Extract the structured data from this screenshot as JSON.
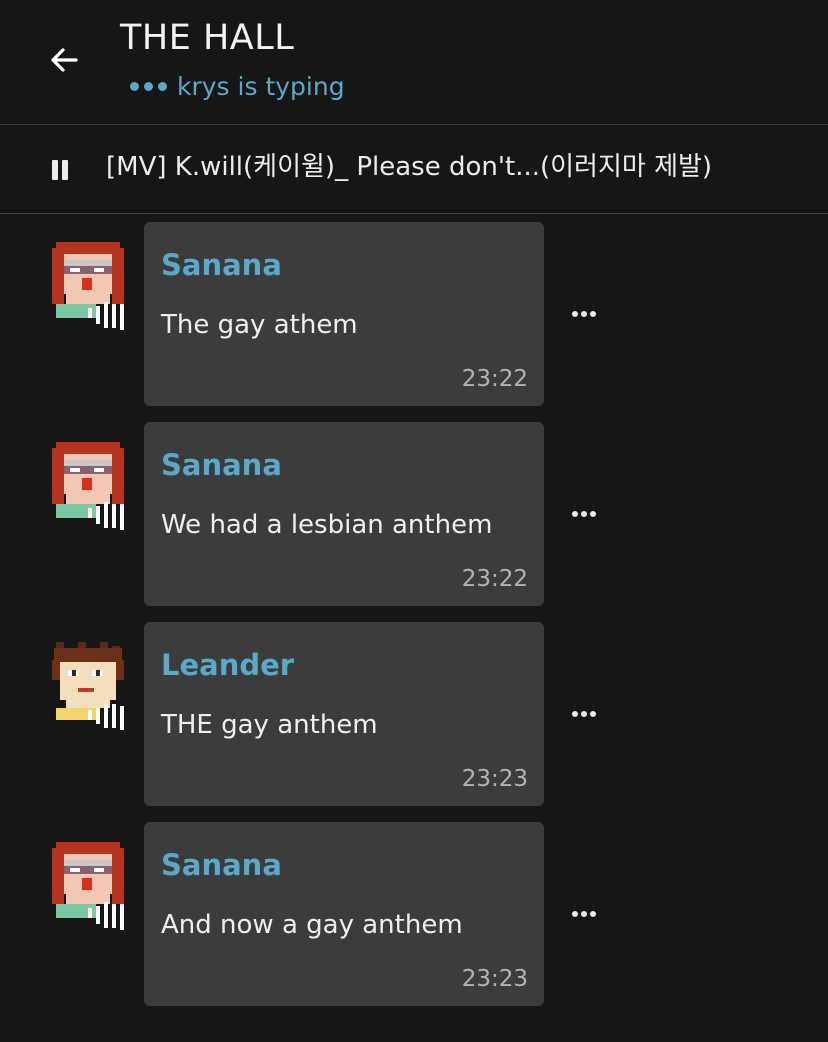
{
  "header": {
    "title": "THE HALL",
    "typing_status": "krys is typing"
  },
  "now_playing": {
    "track_title": "[MV] K.will(케이윌)_ Please don't...(이러지마 제발)"
  },
  "messages": [
    {
      "sender": "Sanana",
      "text": "The gay athem",
      "time": "23:22",
      "avatar": "sanana"
    },
    {
      "sender": "Sanana",
      "text": "We had a lesbian anthem",
      "time": "23:22",
      "avatar": "sanana"
    },
    {
      "sender": "Leander",
      "text": "THE gay anthem",
      "time": "23:23",
      "avatar": "leander"
    },
    {
      "sender": "Sanana",
      "text": "And now a gay anthem",
      "time": "23:23",
      "avatar": "sanana"
    }
  ],
  "colors": {
    "background": "#161616",
    "bubble": "#3c3c3c",
    "accent": "#5aa9c9",
    "divider": "#3d3d3d"
  },
  "icons": {
    "back": "arrow-left-icon",
    "pause": "pause-icon",
    "more": "more-horizontal-icon"
  }
}
